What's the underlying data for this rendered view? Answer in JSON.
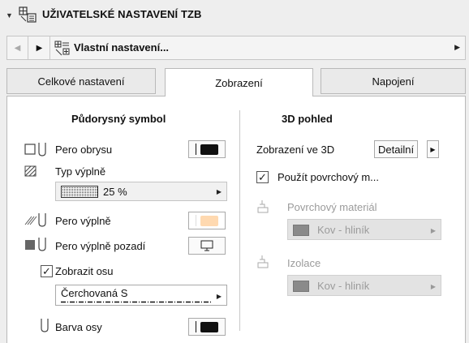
{
  "header": {
    "title": "UŽIVATELSKÉ NASTAVENÍ TZB",
    "collapse_icon": "triangle-down-icon",
    "section_icon": "mep-settings-icon"
  },
  "favorites": {
    "label": "Vlastní nastavení...",
    "prev_icon": "triangle-left-icon",
    "next_icon": "triangle-right-icon",
    "icon": "favorites-icon",
    "more_icon": "triangle-right-icon"
  },
  "tabs": [
    {
      "label": "Celkové nastavení",
      "active": false
    },
    {
      "label": "Zobrazení",
      "active": true
    },
    {
      "label": "Napojení",
      "active": false
    }
  ],
  "floor_plan": {
    "title": "Půdorysný symbol",
    "outline_pen_label": "Pero obrysu",
    "fill_type_label": "Typ výplně",
    "fill_type_value": "25 %",
    "fill_pen_label": "Pero výplně",
    "fill_bg_pen_label": "Pero výplně pozadí",
    "show_axis_label": "Zobrazit osu",
    "show_axis_checked": true,
    "line_type_value": "Čerchovaná S",
    "axis_color_label": "Barva osy",
    "colors": {
      "pen_black": "#111111",
      "fill_pen": "#ffd9b0"
    }
  },
  "view3d": {
    "title": "3D pohled",
    "display_label": "Zobrazení ve 3D",
    "display_value": "Detailní",
    "use_surface_label": "Použít povrchový m...",
    "use_surface_checked": true,
    "surface_material_label": "Povrchový materiál",
    "surface_material_value": "Kov - hliník",
    "insulation_label": "Izolace",
    "insulation_value": "Kov - hliník"
  }
}
